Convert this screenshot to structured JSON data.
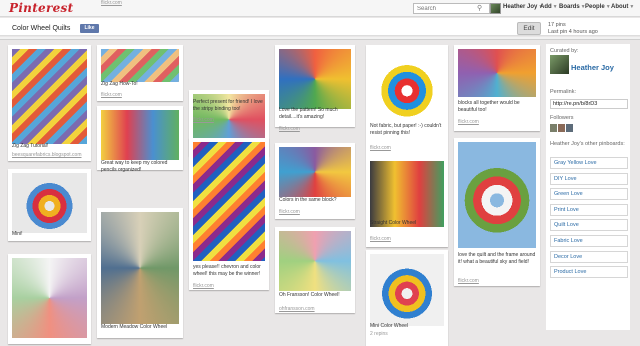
{
  "header": {
    "logo": "Pinterest",
    "search_placeholder": "Search",
    "user_name": "Heather Joy",
    "nav": [
      "Add",
      "Boards",
      "People",
      "About"
    ]
  },
  "board": {
    "title": "Color Wheel Quilts",
    "like_label": "Like",
    "edit_label": "Edit",
    "pin_count": "17 pins",
    "last_pin": "Last pin 4 hours ago"
  },
  "pins": [
    {
      "desc": "Zig Zag Tutorial!",
      "source": "beesquarefabrics.blogspot.com",
      "colors": [
        "#7b6bb0",
        "#f2d23c",
        "#e35a39",
        "#56a6d9"
      ]
    },
    {
      "desc": "Mini!",
      "source": "",
      "colors": [
        "#e8e8e8",
        "#f0b020",
        "#d83040",
        "#4a8ad0"
      ]
    },
    {
      "desc": "",
      "source": "",
      "colors": [
        "#f4f4f4",
        "#c2a0c8",
        "#f09080",
        "#a8d0a0"
      ]
    },
    {
      "desc": "Zig Zag How-To!",
      "source": "flickr.com",
      "colors": [
        "#74b0e0",
        "#f0c080",
        "#e06060",
        "#70c070"
      ]
    },
    {
      "desc": "Great way to keep my colored pencils organized!",
      "source": "flickr.com",
      "colors": [
        "#f2d040",
        "#e04050",
        "#4a90d0",
        "#60b060"
      ]
    },
    {
      "desc": "Modern Meadow Color Wheel",
      "source": "",
      "colors": [
        "#d8d0b8",
        "#709868",
        "#c0a070",
        "#506f90"
      ]
    },
    {
      "desc": "Perfect present for friend! I love the stripy binding too!",
      "source": "flickr.com",
      "colors": [
        "#f2e6a0",
        "#e05060",
        "#60a0d8",
        "#70b860"
      ]
    },
    {
      "desc": "yes please!! chevron and color wheel! this may be the winner!",
      "source": "flickr.com",
      "colors": [
        "#ff8030",
        "#8c2a8c",
        "#2060c0",
        "#f0e040"
      ]
    },
    {
      "desc": "Love the pattern! So much detail....it's amazing!",
      "source": "flickr.com",
      "colors": [
        "#f06040",
        "#f0c030",
        "#50a850",
        "#3070c0"
      ]
    },
    {
      "desc": "Colors in the same block?",
      "source": "flickr.com",
      "colors": [
        "#8a5aa0",
        "#f2c840",
        "#e04040",
        "#40a0d0"
      ]
    },
    {
      "desc": "Oh Fransson! Color Wheel!",
      "source": "ohfransson.com",
      "colors": [
        "#f0a0b0",
        "#80c0e0",
        "#f0e080",
        "#a0d080"
      ]
    },
    {
      "desc": "Not fabric, but paper! :-) couldn't resist pinning this!",
      "source": "flickr.com",
      "colors": [
        "#ffffff",
        "#e83030",
        "#2090e0",
        "#f0d020"
      ]
    },
    {
      "desc": "Straight Color Wheel",
      "source": "flickr.com",
      "colors": [
        "#3b3b40",
        "#f0c030",
        "#e04040",
        "#40a060"
      ]
    },
    {
      "desc": "Mini Color Wheel",
      "source": "2 repins",
      "colors": [
        "#f0f0f0",
        "#e04050",
        "#f0c020",
        "#3080d0"
      ]
    },
    {
      "desc": "blocks all together would be beautiful too!",
      "source": "flickr.com",
      "colors": [
        "#e05050",
        "#f0a030",
        "#50b0d0",
        "#9060b0"
      ]
    },
    {
      "desc": "love the quilt and the frame around it! what a beautiful sky and field!",
      "source": "flickr.com",
      "colors": [
        "#8ab8e0",
        "#f4f4f4",
        "#e04040",
        "#6aa040"
      ]
    }
  ],
  "sidebar": {
    "curated_label": "Curated by:",
    "curator_name": "Heather Joy",
    "permalink_label": "Permalink:",
    "permalink_value": "http://re.pn/b/8rD3",
    "followers_label": "Followers",
    "other_label": "Heather Joy's other pinboards:",
    "other_boards": [
      "Gray Yellow Love",
      "DIY Love",
      "Green Love",
      "Print Love",
      "Quilt Love",
      "Fabric Love",
      "Decor Love",
      "Product Love"
    ]
  },
  "colors": {
    "brand": "#c8232c",
    "link": "#2a6aa5",
    "background": "#e9e7e7"
  }
}
